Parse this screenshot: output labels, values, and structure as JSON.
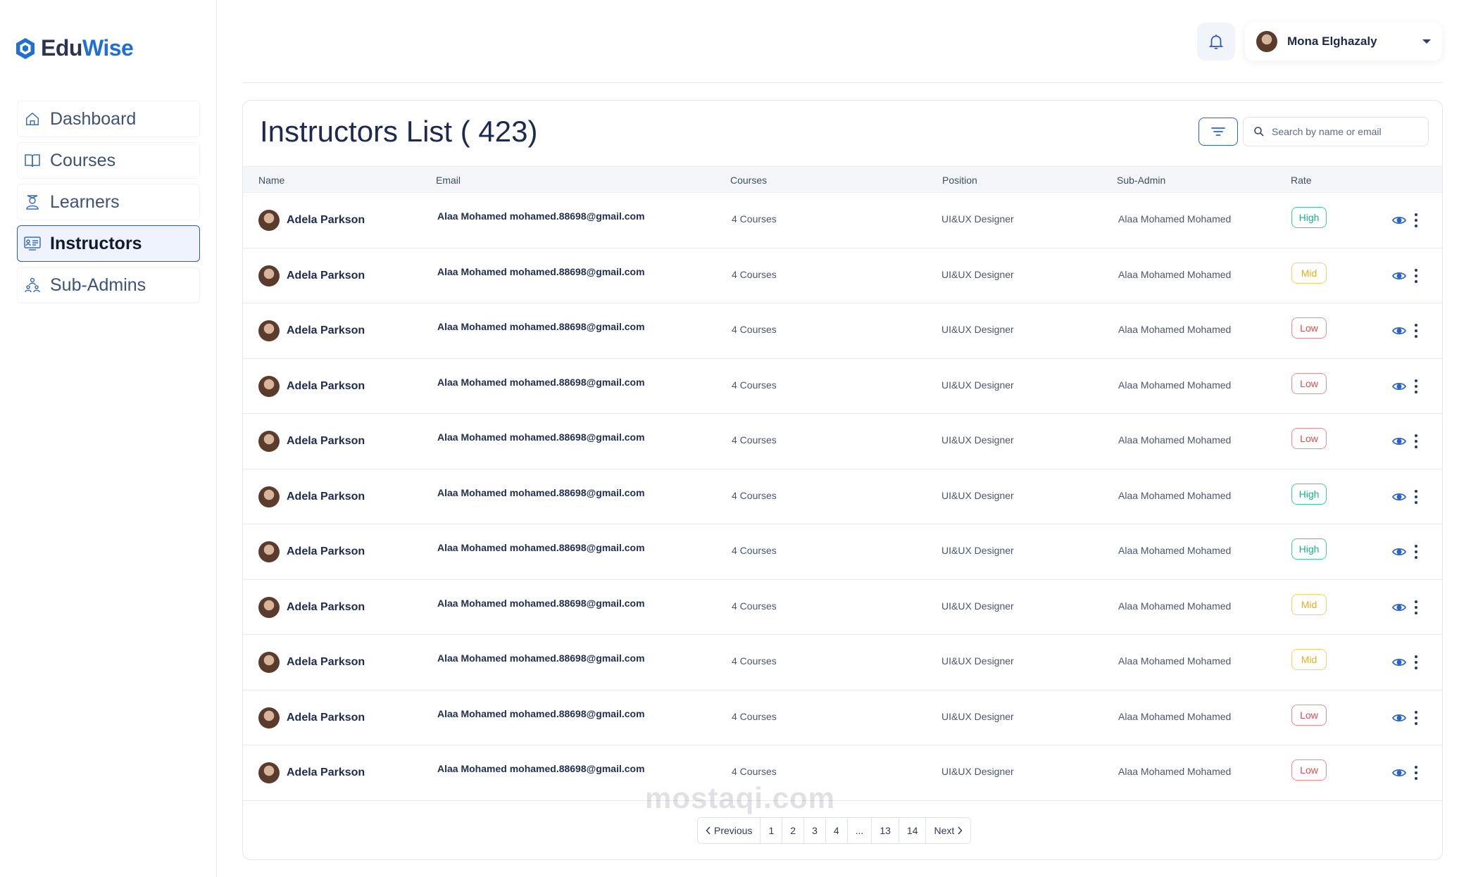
{
  "logo": {
    "part1": "Edu",
    "part2": "Wise"
  },
  "sidebar": {
    "items": [
      {
        "label": "Dashboard",
        "icon": "home-icon"
      },
      {
        "label": "Courses",
        "icon": "book-icon"
      },
      {
        "label": "Learners",
        "icon": "learner-icon"
      },
      {
        "label": "Instructors",
        "icon": "instructor-icon",
        "active": true
      },
      {
        "label": "Sub-Admins",
        "icon": "sub-admin-icon"
      }
    ]
  },
  "header": {
    "user_name": "Mona Elghazaly"
  },
  "main": {
    "title": "Instructors List ( 423)",
    "search_placeholder": "Search by name or email",
    "columns": [
      "Name",
      "Email",
      "Courses",
      "Position",
      "Sub-Admin",
      "Rate"
    ],
    "rows": [
      {
        "name": "Adela Parkson",
        "email": "Alaa Mohamed mohamed.88698@gmail.com",
        "courses": "4 Courses",
        "position": "UI&UX Designer",
        "sub_admin": "Alaa Mohamed Mohamed",
        "rate": "High"
      },
      {
        "name": "Adela Parkson",
        "email": "Alaa Mohamed mohamed.88698@gmail.com",
        "courses": "4 Courses",
        "position": "UI&UX Designer",
        "sub_admin": "Alaa Mohamed Mohamed",
        "rate": "Mid"
      },
      {
        "name": "Adela Parkson",
        "email": "Alaa Mohamed mohamed.88698@gmail.com",
        "courses": "4 Courses",
        "position": "UI&UX Designer",
        "sub_admin": "Alaa Mohamed Mohamed",
        "rate": "Low"
      },
      {
        "name": "Adela Parkson",
        "email": "Alaa Mohamed mohamed.88698@gmail.com",
        "courses": "4 Courses",
        "position": "UI&UX Designer",
        "sub_admin": "Alaa Mohamed Mohamed",
        "rate": "Low"
      },
      {
        "name": "Adela Parkson",
        "email": "Alaa Mohamed mohamed.88698@gmail.com",
        "courses": "4 Courses",
        "position": "UI&UX Designer",
        "sub_admin": "Alaa Mohamed Mohamed",
        "rate": "Low"
      },
      {
        "name": "Adela Parkson",
        "email": "Alaa Mohamed mohamed.88698@gmail.com",
        "courses": "4 Courses",
        "position": "UI&UX Designer",
        "sub_admin": "Alaa Mohamed Mohamed",
        "rate": "High"
      },
      {
        "name": "Adela Parkson",
        "email": "Alaa Mohamed mohamed.88698@gmail.com",
        "courses": "4 Courses",
        "position": "UI&UX Designer",
        "sub_admin": "Alaa Mohamed Mohamed",
        "rate": "High"
      },
      {
        "name": "Adela Parkson",
        "email": "Alaa Mohamed mohamed.88698@gmail.com",
        "courses": "4 Courses",
        "position": "UI&UX Designer",
        "sub_admin": "Alaa Mohamed Mohamed",
        "rate": "Mid"
      },
      {
        "name": "Adela Parkson",
        "email": "Alaa Mohamed mohamed.88698@gmail.com",
        "courses": "4 Courses",
        "position": "UI&UX Designer",
        "sub_admin": "Alaa Mohamed Mohamed",
        "rate": "Mid"
      },
      {
        "name": "Adela Parkson",
        "email": "Alaa Mohamed mohamed.88698@gmail.com",
        "courses": "4 Courses",
        "position": "UI&UX Designer",
        "sub_admin": "Alaa Mohamed Mohamed",
        "rate": "Low"
      },
      {
        "name": "Adela Parkson",
        "email": "Alaa Mohamed mohamed.88698@gmail.com",
        "courses": "4 Courses",
        "position": "UI&UX Designer",
        "sub_admin": "Alaa Mohamed Mohamed",
        "rate": "Low"
      }
    ]
  },
  "pagination": {
    "previous": "Previous",
    "pages": [
      "1",
      "2",
      "3",
      "4",
      "...",
      "13",
      "14"
    ],
    "next": "Next"
  },
  "watermark": "mostaqi.com",
  "colors": {
    "accent": "#1f6fd6",
    "high": "#17b28a",
    "mid": "#e9ae1d",
    "low": "#e04b4b"
  }
}
